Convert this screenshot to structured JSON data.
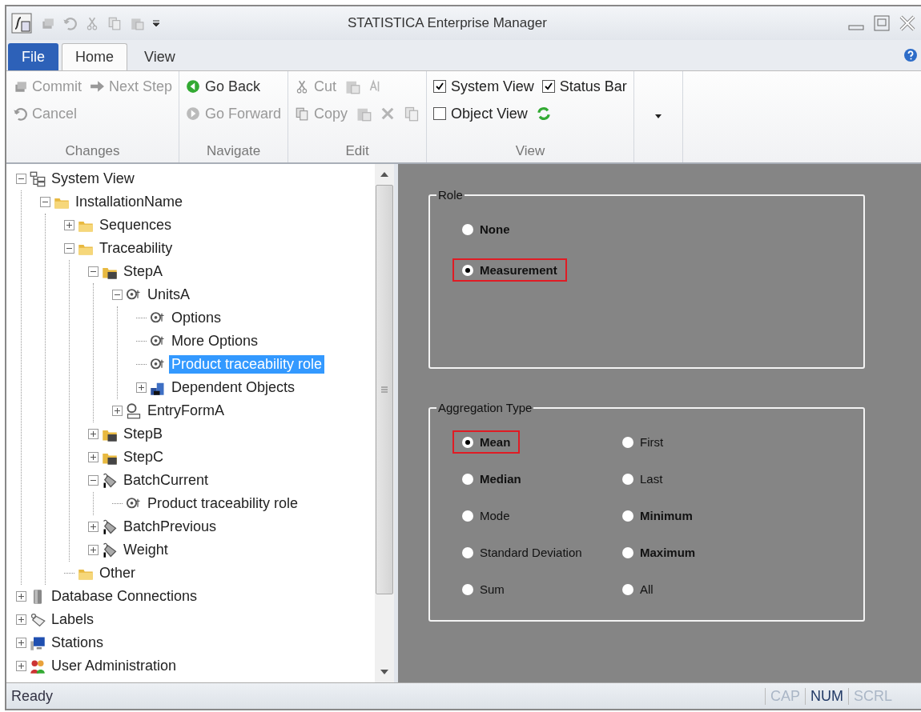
{
  "window": {
    "title": "STATISTICA Enterprise Manager"
  },
  "tabs": [
    {
      "label": "File",
      "kind": "file",
      "selected": false
    },
    {
      "label": "Home",
      "kind": "tab",
      "selected": true
    },
    {
      "label": "View",
      "kind": "tab",
      "selected": false
    }
  ],
  "ribbon": [
    {
      "label": "Changes",
      "rows": [
        [
          {
            "kind": "command",
            "label": "Commit",
            "enabled": false
          },
          {
            "kind": "command",
            "label": "Next Step",
            "enabled": false
          }
        ],
        [
          {
            "kind": "command",
            "label": "Cancel",
            "enabled": false
          }
        ]
      ]
    },
    {
      "label": "Navigate",
      "rows": [
        [
          {
            "kind": "command",
            "label": "Go Back",
            "enabled": true
          }
        ],
        [
          {
            "kind": "command",
            "label": "Go Forward",
            "enabled": false
          }
        ]
      ]
    },
    {
      "label": "Edit",
      "rows": [
        [
          {
            "kind": "command",
            "label": "Cut",
            "enabled": false
          },
          {
            "kind": "icon",
            "enabled": false
          },
          {
            "kind": "icon",
            "enabled": false
          }
        ],
        [
          {
            "kind": "command",
            "label": "Copy",
            "enabled": false
          },
          {
            "kind": "icon",
            "enabled": false
          },
          {
            "kind": "icon",
            "enabled": false
          },
          {
            "kind": "icon",
            "enabled": false
          }
        ]
      ]
    },
    {
      "label": "View",
      "rows": [
        [
          {
            "kind": "checkbox",
            "label": "System View",
            "checked": true
          },
          {
            "kind": "checkbox",
            "label": "Status Bar",
            "checked": true
          }
        ],
        [
          {
            "kind": "checkbox",
            "label": "Object View",
            "checked": false
          },
          {
            "kind": "icon",
            "enabled": true
          }
        ]
      ]
    }
  ],
  "tree": [
    {
      "label": "System View",
      "kind": "system",
      "expanded": true,
      "selected": false,
      "children": [
        {
          "label": "InstallationName",
          "kind": "folder",
          "expanded": true,
          "selected": false,
          "children": [
            {
              "label": "Sequences",
              "kind": "folder",
              "expanded": false,
              "selected": false
            },
            {
              "label": "Traceability",
              "kind": "folder",
              "expanded": true,
              "selected": false,
              "children": [
                {
                  "label": "StepA",
                  "kind": "step",
                  "expanded": true,
                  "selected": false,
                  "children": [
                    {
                      "label": "UnitsA",
                      "kind": "unit",
                      "expanded": true,
                      "selected": false,
                      "children": [
                        {
                          "label": "Options",
                          "kind": "unit",
                          "selected": false
                        },
                        {
                          "label": "More Options",
                          "kind": "unit",
                          "selected": false
                        },
                        {
                          "label": "Product traceability role",
                          "kind": "unit",
                          "selected": true
                        },
                        {
                          "label": "Dependent Objects",
                          "kind": "dependent",
                          "expanded": false,
                          "selected": false
                        }
                      ]
                    },
                    {
                      "label": "EntryFormA",
                      "kind": "form",
                      "expanded": false,
                      "selected": false
                    }
                  ]
                },
                {
                  "label": "StepB",
                  "kind": "step",
                  "expanded": false,
                  "selected": false
                },
                {
                  "label": "StepC",
                  "kind": "step",
                  "expanded": false,
                  "selected": false
                },
                {
                  "label": "BatchCurrent",
                  "kind": "batch",
                  "expanded": true,
                  "selected": false,
                  "children": [
                    {
                      "label": "Product traceability role",
                      "kind": "unit",
                      "selected": false
                    }
                  ]
                },
                {
                  "label": "BatchPrevious",
                  "kind": "batch",
                  "expanded": false,
                  "selected": false
                },
                {
                  "label": "Weight",
                  "kind": "batch",
                  "expanded": false,
                  "selected": false
                }
              ]
            },
            {
              "label": "Other",
              "kind": "folder",
              "selected": false
            }
          ]
        }
      ]
    },
    {
      "label": "Database Connections",
      "kind": "database",
      "expanded": false,
      "selected": false
    },
    {
      "label": "Labels",
      "kind": "label",
      "expanded": false,
      "selected": false
    },
    {
      "label": "Stations",
      "kind": "station",
      "expanded": false,
      "selected": false
    },
    {
      "label": "User Administration",
      "kind": "users",
      "expanded": false,
      "selected": false
    }
  ],
  "groups": [
    {
      "title": "Role",
      "columns": [
        [
          {
            "label": "None",
            "selected": false,
            "bold": true,
            "highlighted": false
          },
          {
            "label": "Measurement",
            "selected": true,
            "bold": true,
            "highlighted": true
          }
        ]
      ]
    },
    {
      "title": "Aggregation Type",
      "columns": [
        [
          {
            "label": "Mean",
            "selected": true,
            "bold": true,
            "highlighted": true
          },
          {
            "label": "Median",
            "selected": false,
            "bold": true,
            "highlighted": false
          },
          {
            "label": "Mode",
            "selected": false,
            "bold": false,
            "highlighted": false
          },
          {
            "label": "Standard Deviation",
            "selected": false,
            "bold": false,
            "highlighted": false
          },
          {
            "label": "Sum",
            "selected": false,
            "bold": false,
            "highlighted": false
          }
        ],
        [
          {
            "label": "First",
            "selected": false,
            "bold": false,
            "highlighted": false
          },
          {
            "label": "Last",
            "selected": false,
            "bold": false,
            "highlighted": false
          },
          {
            "label": "Minimum",
            "selected": false,
            "bold": true,
            "highlighted": false
          },
          {
            "label": "Maximum",
            "selected": false,
            "bold": true,
            "highlighted": false
          },
          {
            "label": "All",
            "selected": false,
            "bold": false,
            "highlighted": false
          }
        ]
      ]
    }
  ],
  "status_bar": {
    "text": "Ready",
    "indicators": [
      {
        "label": "CAP",
        "on": false
      },
      {
        "label": "NUM",
        "on": true
      },
      {
        "label": "SCRL",
        "on": false
      }
    ]
  }
}
